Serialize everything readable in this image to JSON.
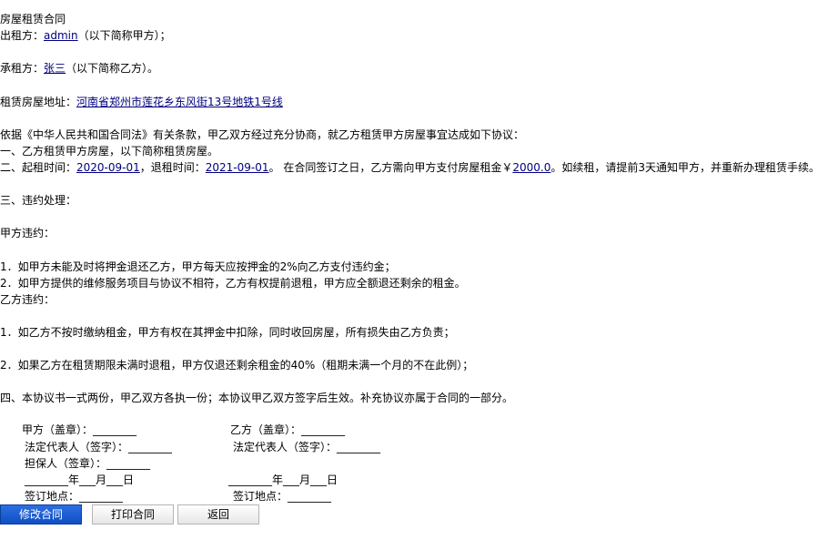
{
  "contract": {
    "title": "房屋租赁合同",
    "lessor_prefix": "出租方：",
    "lessor_name": "admin",
    "lessor_suffix": "（以下简称甲方）；",
    "lessee_prefix": "承租方：",
    "lessee_name": "张三",
    "lessee_suffix": "（以下简称乙方）。",
    "address_prefix": "租赁房屋地址：",
    "address": "河南省郑州市莲花乡东风街13号地铁1号线",
    "agreement_intro": "依据《中华人民共和国合同法》有关条款，甲乙双方经过充分协商，就乙方租赁甲方房屋事宜达成如下协议：",
    "clause1": "一、乙方租赁甲方房屋，以下简称租赁房屋。",
    "clause2_prefix": "二、起租时间：",
    "start_date": "2020-09-01",
    "clause2_mid": "，退租时间：",
    "end_date": "2021-09-01",
    "clause2_rent_text": "。 在合同签订之日，乙方需向甲方支付房屋租金￥",
    "rent": "2000.0",
    "clause2_suffix": "。如续租，请提前3天通知甲方，并重新办理租赁手续。",
    "clause3": "三、违约处理：",
    "party_a_breach_title": "甲方违约：",
    "party_a_breach_1": "1．如甲方未能及时将押金退还乙方，甲方每天应按押金的2%向乙方支付违约金；",
    "party_a_breach_2": "2．如甲方提供的维修服务项目与协议不相符，乙方有权提前退租，甲方应全额退还剩余的租金。",
    "party_b_breach_title": "乙方违约：",
    "party_b_breach_1": "1．如乙方不按时缴纳租金，甲方有权在其押金中扣除，同时收回房屋，所有损失由乙方负责；",
    "party_b_breach_2": "2．如果乙方在租赁期限未满时退租，甲方仅退还剩余租金的40%（租期未满一个月的不在此例）；",
    "clause4": "四、本协议书一式两份，甲乙双方各执一份；本协议甲乙双方签字后生效。补充协议亦属于合同的一部分。"
  },
  "signatures": {
    "a_seal": "甲方（盖章）：________",
    "a_rep": "法定代表人（签字）：________",
    "a_guarantor": "担保人（签章）：________",
    "a_date": "________年___月___日",
    "a_place": "签订地点：________",
    "b_seal": "乙方（盖章）：________",
    "b_rep": "法定代表人（签字）：________",
    "b_date": "________年___月___日",
    "b_place": "签订地点：________"
  },
  "buttons": {
    "edit": "修改合同",
    "print": "打印合同",
    "back": "返回"
  },
  "colors": {
    "primary": "#1a5fd6",
    "link": "#000080"
  }
}
